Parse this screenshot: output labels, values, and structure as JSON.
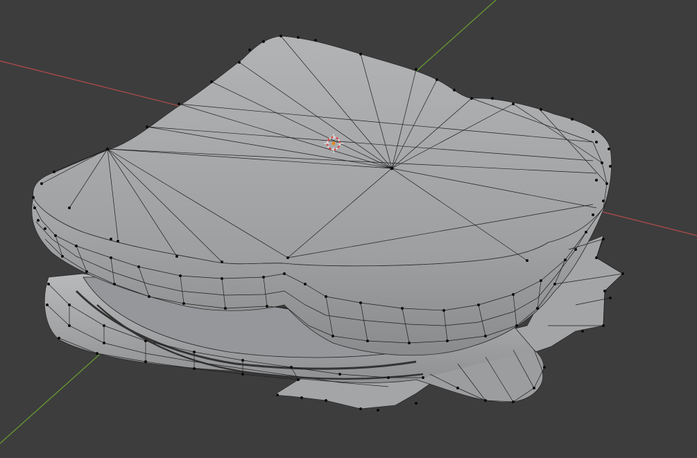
{
  "viewport": {
    "mode": "3d-viewport",
    "background": "#3d3d3d",
    "overlay": "wireframe-with-vertices",
    "x_axis_color": "#c05050",
    "y_axis_color": "#6aa12e",
    "mesh_color": "#a7a8aa",
    "object": "sandwich-mesh",
    "cursor": "3d-cursor"
  }
}
